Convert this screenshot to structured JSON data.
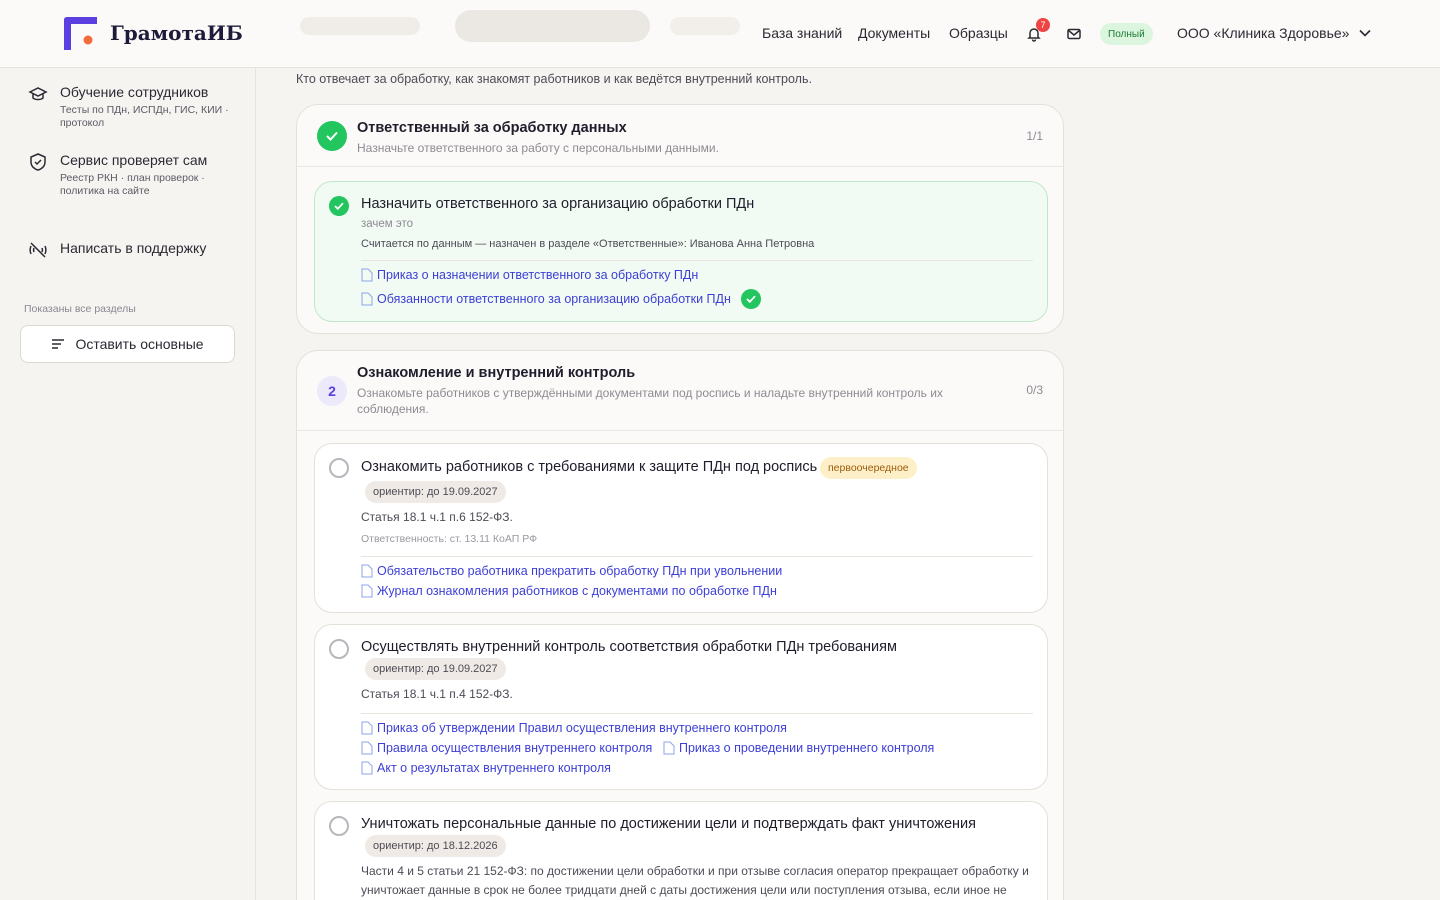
{
  "header": {
    "logo_text": "ГрамотаИБ",
    "nav": [
      "База знаний",
      "Документы",
      "Образцы"
    ],
    "notifications_count": "7",
    "plan_badge": "Полный",
    "org_name": "ООО «Клиника Здоровье»"
  },
  "sidebar": {
    "items": [
      {
        "title": "Обучение сотрудников",
        "sub": "Тесты по ПДн, ИСПДн, ГИС, КИИ · протокол",
        "icon": "graduation-icon"
      },
      {
        "title": "Сервис проверяет сам",
        "sub": "Реестр РКН · план проверок · политика на сайте",
        "icon": "shield-check-icon"
      },
      {
        "title": "Написать в поддержку",
        "sub": "",
        "icon": "signal-off-icon"
      }
    ],
    "note": "Показаны все разделы",
    "button": "Оставить основные"
  },
  "main": {
    "intro": "Кто отвечает за обработку, как знакомят работников и как ведётся внутренний контроль.",
    "sections": [
      {
        "title": "Ответственный за обработку данных",
        "sub": "Назначьте ответственного за работу с персональными данными.",
        "count": "1/1",
        "tasks": [
          {
            "title": "Назначить ответственного за организацию обработки ПДн",
            "why": "зачем это",
            "text": "Считается по данным — назначен в разделе «Ответственные»: Иванова Анна Петровна",
            "docs": [
              "Приказ о назначении ответственного за обработку ПДн",
              "Обязанности ответственного за организацию обработки ПДн"
            ]
          }
        ]
      },
      {
        "number": "2",
        "title": "Ознакомление и внутренний контроль",
        "sub": "Ознакомьте работников с утверждёнными документами под роспись и наладьте внутренний контроль их соблюдения.",
        "count": "0/3",
        "tasks": [
          {
            "title": "Ознакомить работников с требованиями к защите ПДн под роспись",
            "priority": "первоочередное",
            "deadline": "ориентир: до 19.09.2027",
            "text": "Статья 18.1 ч.1 п.6 152-ФЗ.",
            "note": "Ответственность: ст. 13.11 КоАП РФ",
            "docs": [
              "Обязательство работника прекратить обработку ПДн при увольнении",
              "Журнал ознакомления работников с документами по обработке ПДн"
            ]
          },
          {
            "title": "Осуществлять внутренний контроль соответствия обработки ПДн требованиям",
            "deadline": "ориентир: до 19.09.2027",
            "text": "Статья 18.1 ч.1 п.4 152-ФЗ.",
            "docs": [
              "Приказ об утверждении Правил осуществления внутреннего контроля",
              "Правила осуществления внутреннего контроля",
              "Приказ о проведении внутреннего контроля",
              "Акт о результатах внутреннего контроля"
            ]
          },
          {
            "title": "Уничтожать персональные данные по достижении цели и подтверждать факт уничтожения",
            "deadline": "ориентир: до 18.12.2026",
            "text": "Части 4 и 5 статьи 21 152-ФЗ: по достижении цели обработки и при отзыве согласия оператор прекращает обработку и уничтожает данные в срок не более тридцати дней с даты достижения цели или поступления отзыва, если иное не"
          }
        ]
      }
    ]
  },
  "colors": {
    "accent": "#5b3fe0",
    "logo_dot": "#f26b3a",
    "success": "#22c55e",
    "link": "#3d3fd6"
  }
}
